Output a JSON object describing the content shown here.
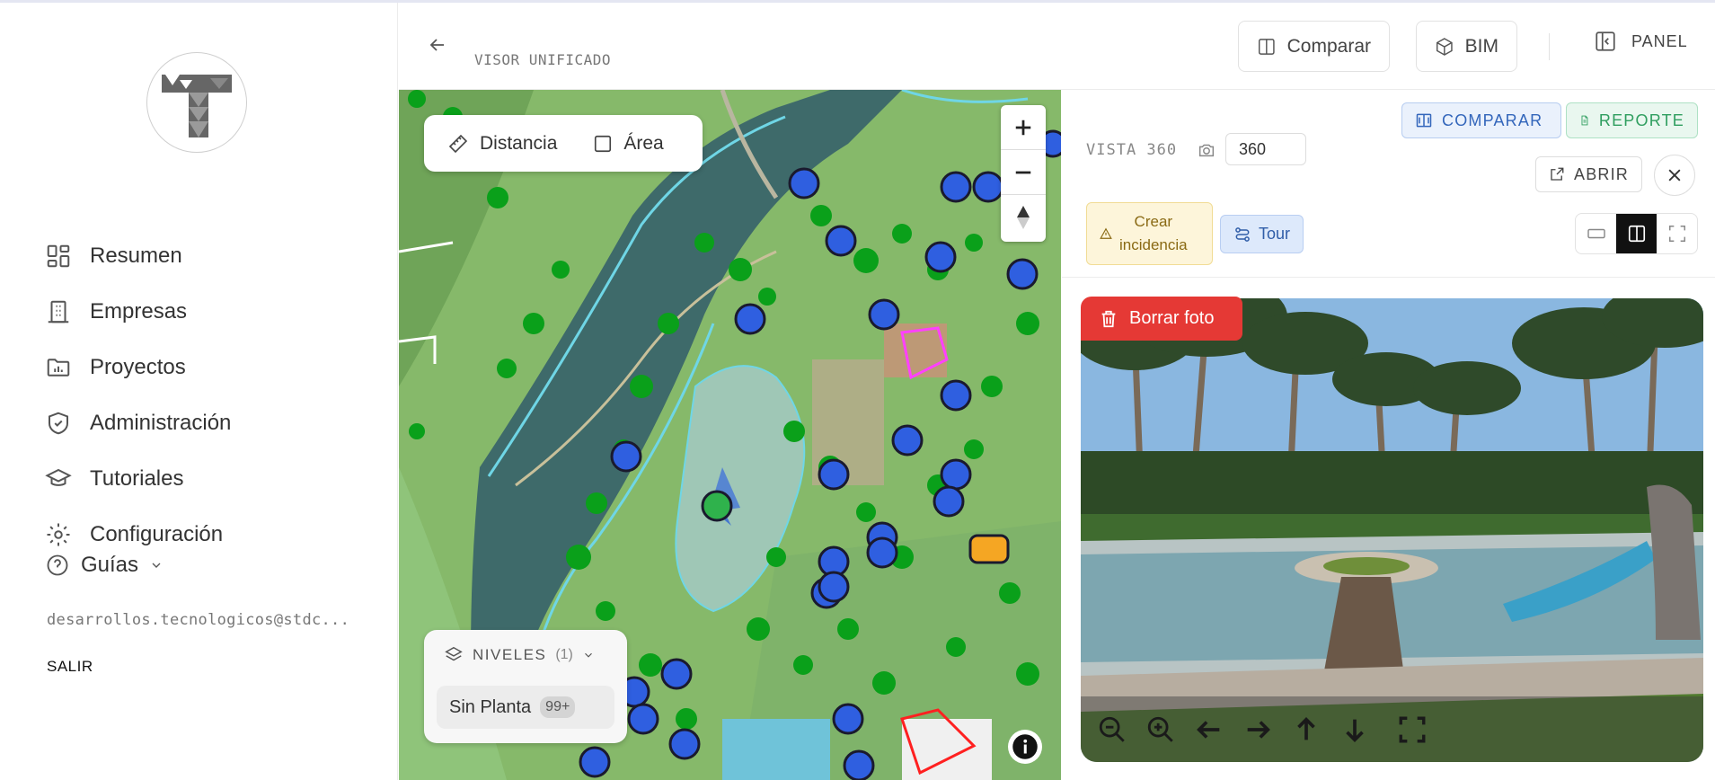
{
  "sidebar": {
    "logo_alt": "T",
    "items": [
      {
        "label": "Resumen",
        "icon": "dashboard-icon"
      },
      {
        "label": "Empresas",
        "icon": "building-icon"
      },
      {
        "label": "Proyectos",
        "icon": "folder-chart-icon"
      },
      {
        "label": "Administración",
        "icon": "shield-check-icon"
      },
      {
        "label": "Tutoriales",
        "icon": "graduation-cap-icon"
      },
      {
        "label": "Configuración",
        "icon": "gear-icon"
      }
    ],
    "guias_label": "Guías",
    "email": "desarrollos.tecnologicos@stdc...",
    "salir_label": "SALIR"
  },
  "header": {
    "title": "VISOR UNIFICADO",
    "compare_label": "Comparar",
    "bim_label": "BIM",
    "panel_label": "PANEL"
  },
  "map": {
    "distance_label": "Distancia",
    "area_label": "Área",
    "levels_label": "NIVELES",
    "levels_count": "(1)",
    "level_name": "Sin Planta",
    "level_badge": "99+"
  },
  "panel": {
    "vista_label": "VISTA 360",
    "vista_value": "360",
    "compare_label": "COMPARAR",
    "report_label": "REPORTE",
    "open_label": "ABRIR",
    "create_issue_line1": "Crear",
    "create_issue_line2": "incidencia",
    "tour_label": "Tour",
    "delete_photo_label": "Borrar foto"
  },
  "colors": {
    "delete": "#e53935",
    "compare_blue": "#3366bb",
    "report_green": "#2f9e5f",
    "marker_blue": "#2f5fe0",
    "marker_green": "#2fb24c",
    "marker_orange": "#f5a623"
  }
}
